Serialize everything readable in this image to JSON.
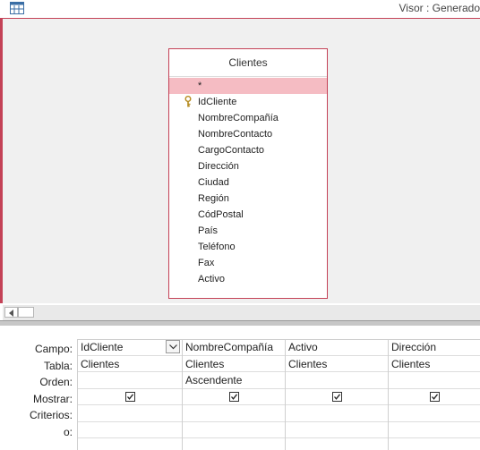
{
  "window": {
    "title": "Visor : Generado"
  },
  "table": {
    "title": "Clientes",
    "fields": [
      "*",
      "IdCliente",
      "NombreCompañía",
      "NombreContacto",
      "CargoContacto",
      "Dirección",
      "Ciudad",
      "Región",
      "CódPostal",
      "País",
      "Teléfono",
      "Fax",
      "Activo"
    ],
    "key_field": "IdCliente"
  },
  "grid": {
    "row_labels": {
      "campo": "Campo:",
      "tabla": "Tabla:",
      "orden": "Orden:",
      "mostrar": "Mostrar:",
      "criterios": "Criterios:",
      "o": "o:"
    },
    "columns": [
      {
        "campo": "IdCliente",
        "tabla": "Clientes",
        "orden": "",
        "mostrar": true
      },
      {
        "campo": "NombreCompañía",
        "tabla": "Clientes",
        "orden": "Ascendente",
        "mostrar": true
      },
      {
        "campo": "Activo",
        "tabla": "Clientes",
        "orden": "",
        "mostrar": true
      },
      {
        "campo": "Dirección",
        "tabla": "Clientes",
        "orden": "",
        "mostrar": true
      }
    ]
  },
  "colors": {
    "accent": "#c44257",
    "selected_row": "#f5bcc3",
    "pane_bg": "#f0f0f0"
  },
  "icons": {
    "app": "query-design-icon",
    "key": "primary-key-icon",
    "scroll_left": "scroll-left-arrow-icon",
    "dropdown": "chevron-down-icon",
    "checkbox": "checkmark-icon"
  }
}
